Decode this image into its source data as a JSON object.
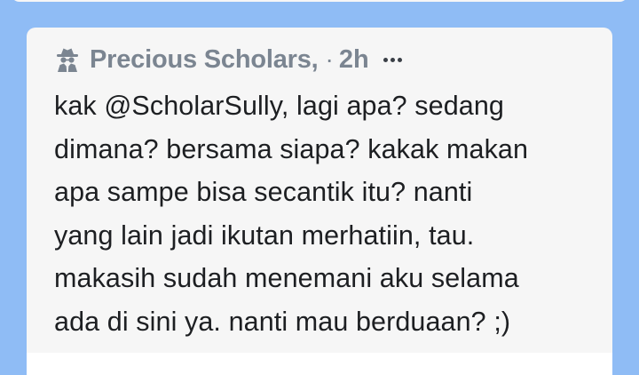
{
  "post": {
    "author": "Precious Scholars,",
    "separator": "·",
    "time": "2h",
    "author_icon": "spy-icon",
    "more_icon": "more-dots-icon",
    "message_lines": [
      "kak @ScholarSully, lagi apa? sedang",
      "dimana? bersama siapa? kakak makan",
      "apa sampe bisa secantik itu? nanti",
      "yang lain jadi ikutan merhatiin, tau.",
      "makasih sudah menemani aku selama",
      "ada di sini ya. nanti mau berduaan? ;)"
    ]
  },
  "colors": {
    "background": "#8fbcf5",
    "card": "#f6f6f6",
    "meta_text": "#7b8591",
    "body_text": "#1d1f22"
  }
}
